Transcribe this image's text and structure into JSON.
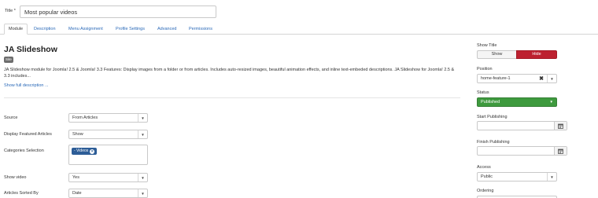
{
  "title_field": {
    "label": "Title *",
    "value": "Most popular videos"
  },
  "tabs": [
    {
      "label": "Module"
    },
    {
      "label": "Description"
    },
    {
      "label": "Menu Assignment"
    },
    {
      "label": "Profile Settings"
    },
    {
      "label": "Advanced"
    },
    {
      "label": "Permissions"
    }
  ],
  "module": {
    "name": "JA Slideshow",
    "badge": "Site",
    "description": "JA Slideshow module for Joomla! 2.5 & Joomla! 3.3 Features: Display images from a folder or from articles. Includes auto-resized images, beautiful animation effects, and inline text-embeded descriptions. JA Slideshow for Joomla! 2.5 & 3.3 includes...",
    "show_more": "Show full description ..."
  },
  "form": {
    "source": {
      "label": "Source",
      "value": "From Articles"
    },
    "featured": {
      "label": "Display Featured Articles",
      "value": "Show"
    },
    "categories": {
      "label": "Categories Selection",
      "tag": "- Videos"
    },
    "show_video": {
      "label": "Show video",
      "value": "Yes"
    },
    "sorted_by": {
      "label": "Articles Sorted By",
      "value": "Date"
    }
  },
  "sidebar": {
    "show_title": {
      "label": "Show Title",
      "show": "Show",
      "hide": "Hide"
    },
    "position": {
      "label": "Position",
      "value": "home-feature-1"
    },
    "status": {
      "label": "Status",
      "value": "Published"
    },
    "start_publishing": {
      "label": "Start Publishing",
      "value": ""
    },
    "finish_publishing": {
      "label": "Finish Publishing",
      "value": ""
    },
    "access": {
      "label": "Access",
      "value": "Public"
    },
    "ordering": {
      "label": "Ordering"
    }
  },
  "colors": {
    "accent": "#2a69b8",
    "danger": "#bd2130",
    "success": "#3e9a3e",
    "badge": "#6d6d6d",
    "tag": "#2d5d97"
  }
}
